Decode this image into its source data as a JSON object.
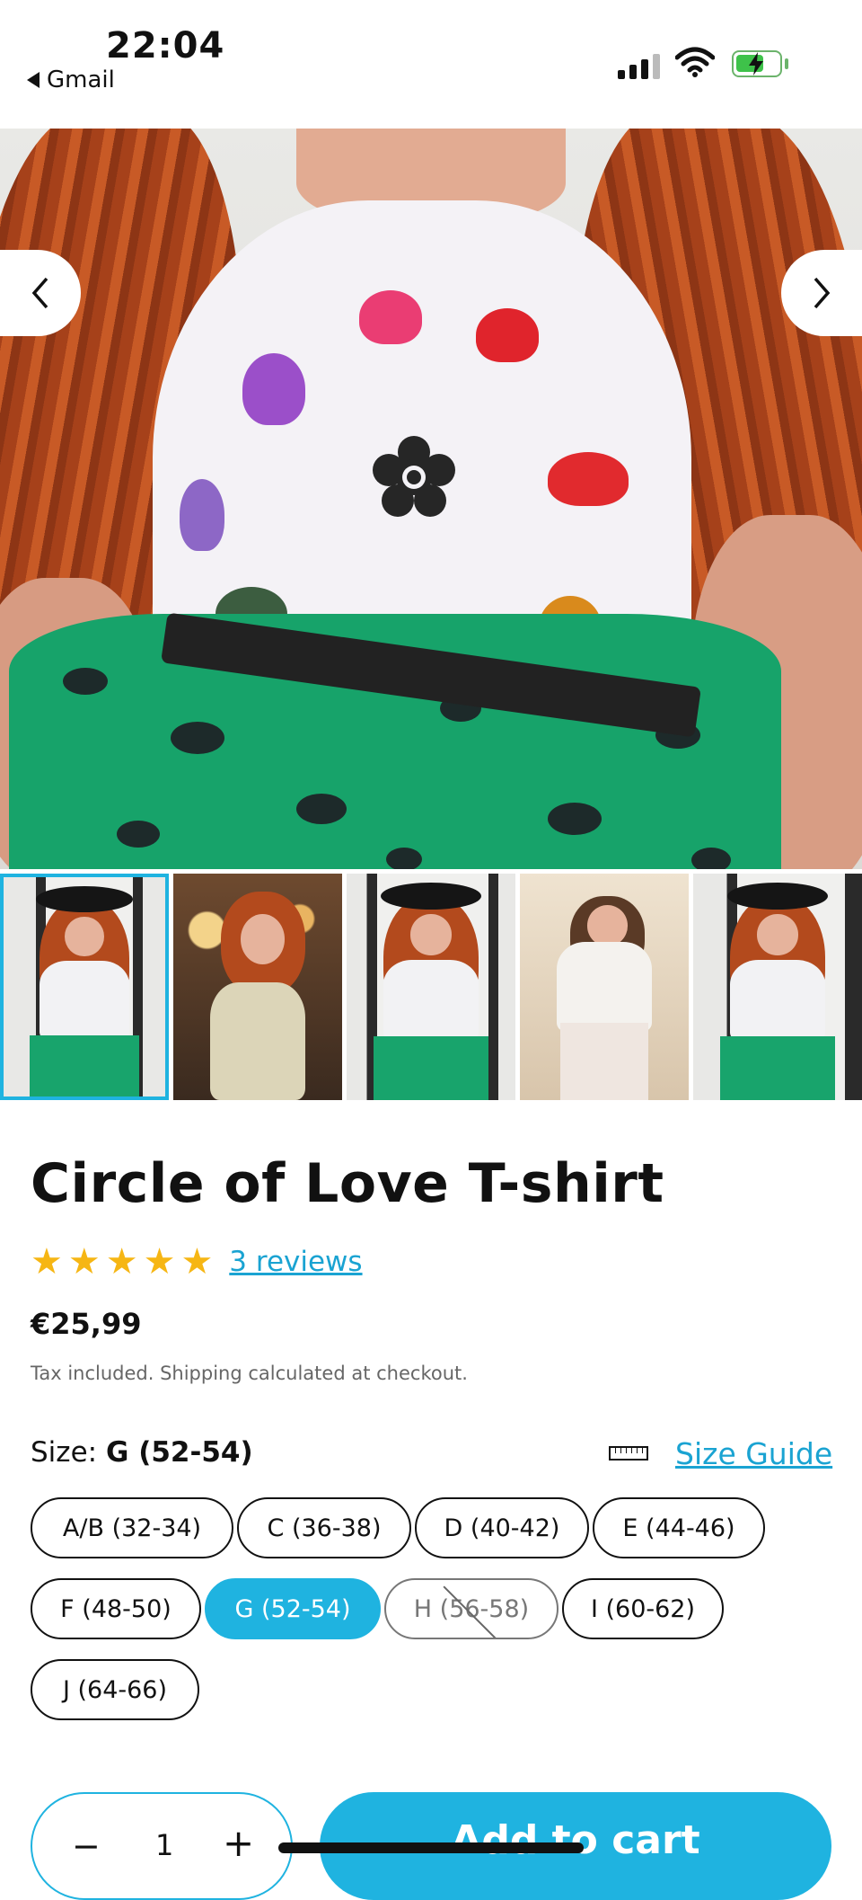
{
  "status_bar": {
    "time": "22:04",
    "back_app": "Gmail"
  },
  "product": {
    "title": "Circle of Love T-shirt",
    "stars": 5,
    "reviews_link": "3 reviews",
    "price": "€25,99",
    "tax_note": "Tax included. Shipping calculated at checkout."
  },
  "size": {
    "label": "Size:",
    "selected": "G (52-54)",
    "guide_label": "Size Guide",
    "options": [
      "A/B (32-34)",
      "C (36-38)",
      "D (40-42)",
      "E (44-46)",
      "F (48-50)",
      "G (52-54)",
      "H (56-58)",
      "I (60-62)",
      "J (64-66)"
    ]
  },
  "cart": {
    "quantity": "1",
    "minus": "−",
    "plus": "+",
    "add_label": "Add to cart"
  },
  "colors": {
    "accent": "#1fb3e0",
    "star": "#f6b614"
  }
}
